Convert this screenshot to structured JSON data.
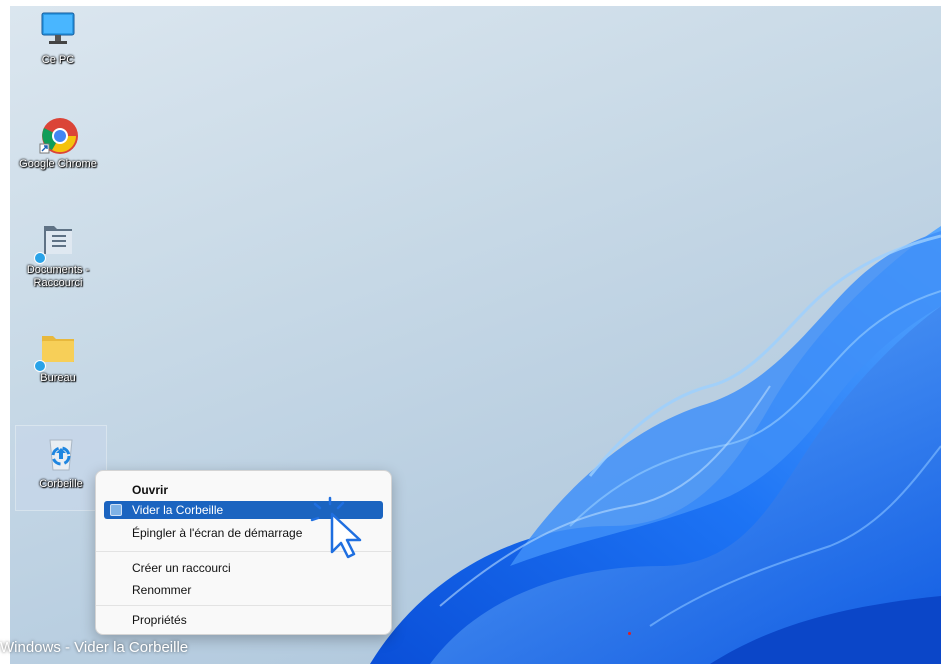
{
  "desktop": {
    "icons": [
      {
        "label": "Ce PC",
        "icon": "monitor-icon"
      },
      {
        "label": "Google Chrome",
        "icon": "chrome-icon"
      },
      {
        "label": "Documents -",
        "label2": "Raccourci",
        "icon": "documents-folder-icon"
      },
      {
        "label": "Bureau",
        "icon": "folder-icon"
      },
      {
        "label": "Corbeille",
        "icon": "recycle-bin-icon"
      }
    ]
  },
  "context_menu": {
    "items": [
      {
        "label": "Ouvrir"
      },
      {
        "label": "Vider la Corbeille",
        "icon": "recycle-bin-icon"
      },
      {
        "label": "Épingler à l'écran de démarrage"
      },
      {
        "label": "Créer un raccourci"
      },
      {
        "label": "Renommer"
      },
      {
        "label": "Propriétés"
      }
    ]
  },
  "caption": "Windows - Vider la Corbeille",
  "colors": {
    "highlight": "#1b64c0",
    "wallpaper_blue": "#1e6cf0"
  }
}
